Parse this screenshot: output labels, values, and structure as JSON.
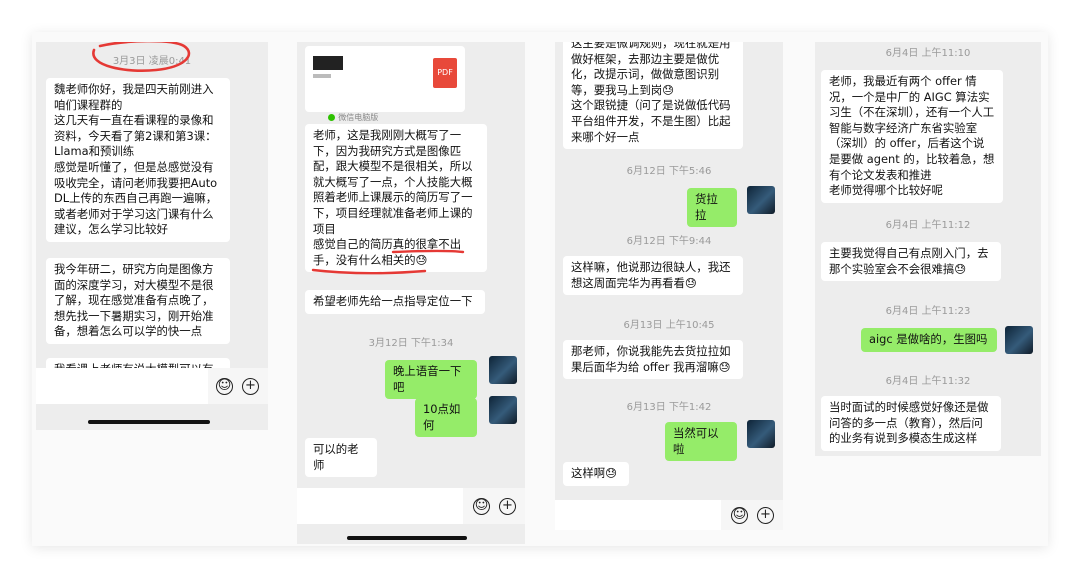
{
  "panel1": {
    "timestamp": "3月3日 凌晨0:41",
    "msg1": "魏老师你好，我是四天前刚进入咱们课程群的\n这几天有一直在看课程的录像和资料，今天看了第2课和第3课：Llama和预训练\n感觉是听懂了，但是总感觉没有吸收完全，请问老师我要把AutoDL上传的东西自己再跑一遍嘛，或者老师对于学习这门课有什么建议，怎么学习比较好",
    "msg2": "我今年研二，研究方向是图像方面的深度学习，对大模型不是很了解，现在感觉准备有点晚了，想先找一下暑期实习，刚开始准备，想着怎么可以学的快一点",
    "msg3_partial": "我看课上老师有说大模型可以有",
    "emoji_glyph": "☺",
    "plus_glyph": "+"
  },
  "panel2": {
    "file_label": "PDF",
    "file_source": "微信电脑版",
    "msg1": "老师，这是我刚刚大概写了一下，因为我研究方式是图像匹配，跟大模型不是很相关，所以就大概写了一点，个人技能大概照着老师上课展示的简历写了一下，项目经理就准备老师上课的项目\n感觉自己的简历真的很拿不出手，没有什么相关的😓",
    "msg2": "希望老师先给一点指导定位一下",
    "ts1": "3月12日 下午1:34",
    "out1": "晚上语音一下吧",
    "out2": "10点如何",
    "msg3": "可以的老师",
    "emoji_glyph": "☺",
    "plus_glyph": "+"
  },
  "panel3": {
    "msg1": "这主要是微调规则，现在就是用做好框架，去那边主要是做优化，改提示词，做做意图识别等，要我马上到岗😓\n这个跟锐捷（问了是说做低代码平台组件开发，不是生图）比起来哪个好一点",
    "ts1": "6月12日 下午5:46",
    "out1": "货拉拉",
    "ts2": "6月12日 下午9:44",
    "msg2": "这样嘛，他说那边很缺人，我还想这周面完华为再看看😓",
    "ts3": "6月13日 上午10:45",
    "msg3": "那老师，你说我能先去货拉拉如果后面华为给 offer 我再溜嘛😓",
    "ts4": "6月13日 下午1:42",
    "out2": "当然可以啦",
    "msg4": "这样啊😓",
    "emoji_glyph": "☺",
    "plus_glyph": "+"
  },
  "panel4": {
    "ts1": "6月4日 上午11:10",
    "msg1": "老师，我最近有两个 offer 情况，一个是中厂的 AIGC 算法实习生（不在深圳），还有一个人工智能与数字经济广东省实验室（深圳）的 offer，后者这个说是要做 agent 的，比较着急，想有个论文发表和推进\n老师觉得哪个比较好呢",
    "ts2": "6月4日 上午11:12",
    "msg2": "主要我觉得自己有点刚入门，去那个实验室会不会很难搞😓",
    "ts3": "6月4日 上午11:23",
    "out1": "aigc 是做啥的，生图吗",
    "ts4": "6月4日 上午11:32",
    "msg3": "当时面试的时候感觉好像还是做问答的多一点（教育），然后问的业务有说到多模态生成这样"
  },
  "colors": {
    "outgoing": "#95ec69",
    "incoming": "#ffffff",
    "chat_bg": "#ededed",
    "annotation": "#e53935"
  }
}
